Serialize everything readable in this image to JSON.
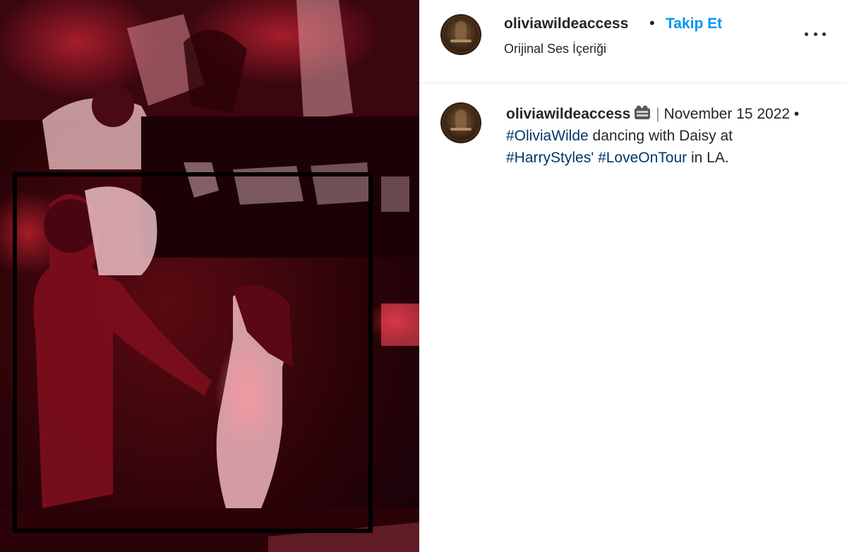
{
  "post": {
    "author": "oliviawildeaccess",
    "follow_label": "Takip Et",
    "separator": "•",
    "audio_label": "Orijinal Ses İçeriği"
  },
  "caption": {
    "author": "oliviawildeaccess",
    "pipe": "|",
    "date_text": "November 15 2022",
    "bullet": "•",
    "hashtag1": "#OliviaWilde",
    "text1": "dancing with Daisy at",
    "hashtag2": "#HarryStyles'",
    "hashtag3": "#LoveOnTour",
    "text2": "in LA."
  },
  "icons": {
    "more": "more-horizontal-icon",
    "film": "film-camera-icon"
  },
  "colors": {
    "follow": "#0095f6",
    "hashtag": "#00376b",
    "text": "#262626",
    "highlight_box": "#000000"
  }
}
